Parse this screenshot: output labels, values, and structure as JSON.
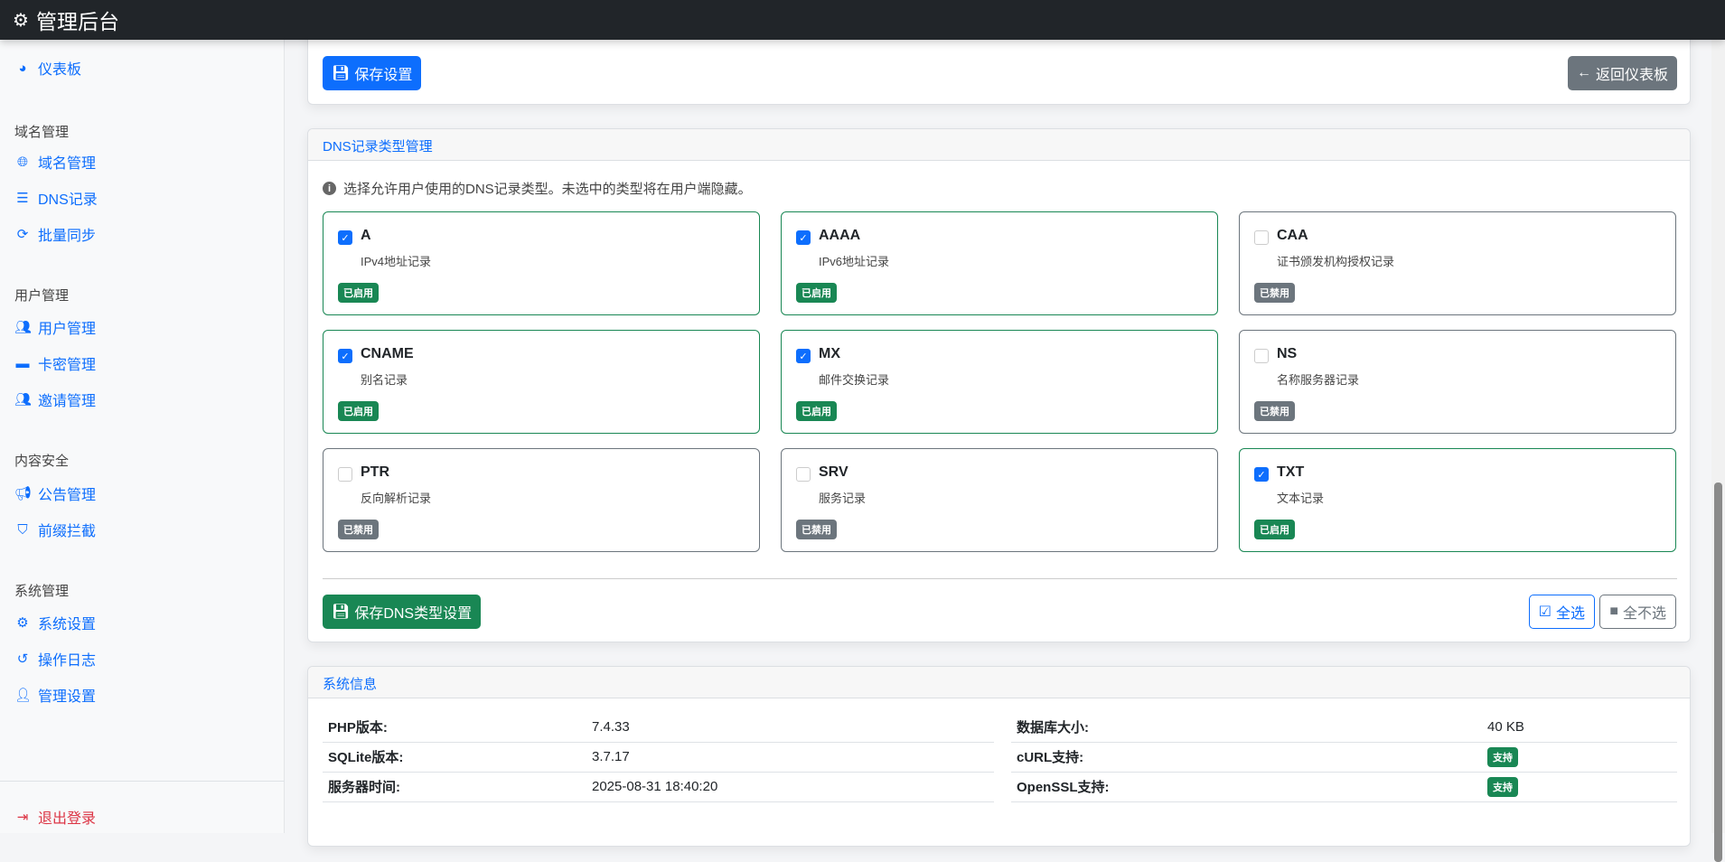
{
  "header": {
    "title": "管理后台",
    "icon": "cogs-icon"
  },
  "sidebar": {
    "dashboard": "仪表板",
    "sections": [
      {
        "title": "域名管理",
        "items": [
          "域名管理",
          "DNS记录",
          "批量同步"
        ]
      },
      {
        "title": "用户管理",
        "items": [
          "用户管理",
          "卡密管理",
          "邀请管理"
        ]
      },
      {
        "title": "内容安全",
        "items": [
          "公告管理",
          "前缀拦截"
        ]
      },
      {
        "title": "系统管理",
        "items": [
          "系统设置",
          "操作日志",
          "管理设置"
        ]
      }
    ],
    "logout": "退出登录"
  },
  "settings_card": {
    "save": "保存设置",
    "back": "返回仪表板"
  },
  "dns_card": {
    "title": "DNS记录类型管理",
    "info": "选择允许用户使用的DNS记录类型。未选中的类型将在用户端隐藏。",
    "types": [
      {
        "name": "A",
        "desc": "IPv4地址记录",
        "enabled": true,
        "status": "已启用"
      },
      {
        "name": "AAAA",
        "desc": "IPv6地址记录",
        "enabled": true,
        "status": "已启用"
      },
      {
        "name": "CAA",
        "desc": "证书颁发机构授权记录",
        "enabled": false,
        "status": "已禁用"
      },
      {
        "name": "CNAME",
        "desc": "别名记录",
        "enabled": true,
        "status": "已启用"
      },
      {
        "name": "MX",
        "desc": "邮件交换记录",
        "enabled": true,
        "status": "已启用"
      },
      {
        "name": "NS",
        "desc": "名称服务器记录",
        "enabled": false,
        "status": "已禁用"
      },
      {
        "name": "PTR",
        "desc": "反向解析记录",
        "enabled": false,
        "status": "已禁用"
      },
      {
        "name": "SRV",
        "desc": "服务记录",
        "enabled": false,
        "status": "已禁用"
      },
      {
        "name": "TXT",
        "desc": "文本记录",
        "enabled": true,
        "status": "已启用"
      }
    ],
    "save": "保存DNS类型设置",
    "select_all": "全选",
    "select_none": "全不选"
  },
  "sysinfo": {
    "title": "系统信息",
    "left": [
      {
        "k": "PHP版本:",
        "v": "7.4.33"
      },
      {
        "k": "SQLite版本:",
        "v": "3.7.17"
      },
      {
        "k": "服务器时间:",
        "v": "2025-08-31 18:40:20"
      }
    ],
    "right": [
      {
        "k": "数据库大小:",
        "v": "40 KB"
      },
      {
        "k": "cURL支持:",
        "v": "支持"
      },
      {
        "k": "OpenSSL支持:",
        "v": "支持"
      }
    ]
  }
}
